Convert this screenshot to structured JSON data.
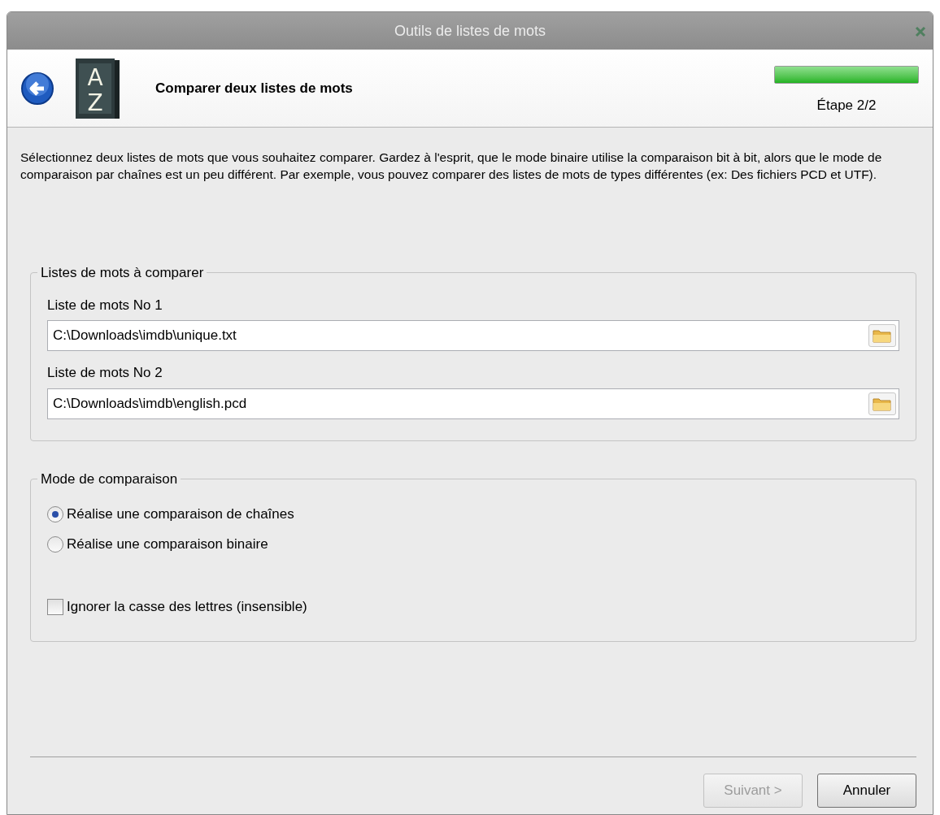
{
  "window": {
    "title": "Outils de listes de mots"
  },
  "header": {
    "icon_letters": [
      "A",
      "Z"
    ],
    "title": "Comparer deux listes de mots",
    "progress": {
      "level": 1
    },
    "step": "Étape 2/2"
  },
  "description": "Sélectionnez deux listes de mots que vous souhaitez comparer. Gardez à l'esprit, que le mode binaire utilise la comparaison bit à bit, alors que le mode de comparaison par chaînes est un peu différent. Par exemple, vous pouvez comparer des listes de mots de types différentes (ex: Des fichiers PCD et UTF).",
  "wordlists": {
    "legend": "Listes de mots à comparer",
    "fields": [
      {
        "label": "Liste de mots No 1",
        "value": "C:\\Downloads\\imdb\\unique.txt"
      },
      {
        "label": "Liste de mots No 2",
        "value": "C:\\Downloads\\imdb\\english.pcd"
      }
    ]
  },
  "mode": {
    "legend": "Mode de comparaison",
    "options": [
      {
        "label": "Réalise une comparaison de chaînes",
        "selected": true
      },
      {
        "label": "Réalise une comparaison binaire",
        "selected": false
      }
    ],
    "checkbox": {
      "label": "Ignorer la casse des lettres (insensible)",
      "checked": false
    }
  },
  "buttons": [
    {
      "label": "Suivant >",
      "disabled": true
    },
    {
      "label": "Annuler",
      "disabled": false
    }
  ]
}
